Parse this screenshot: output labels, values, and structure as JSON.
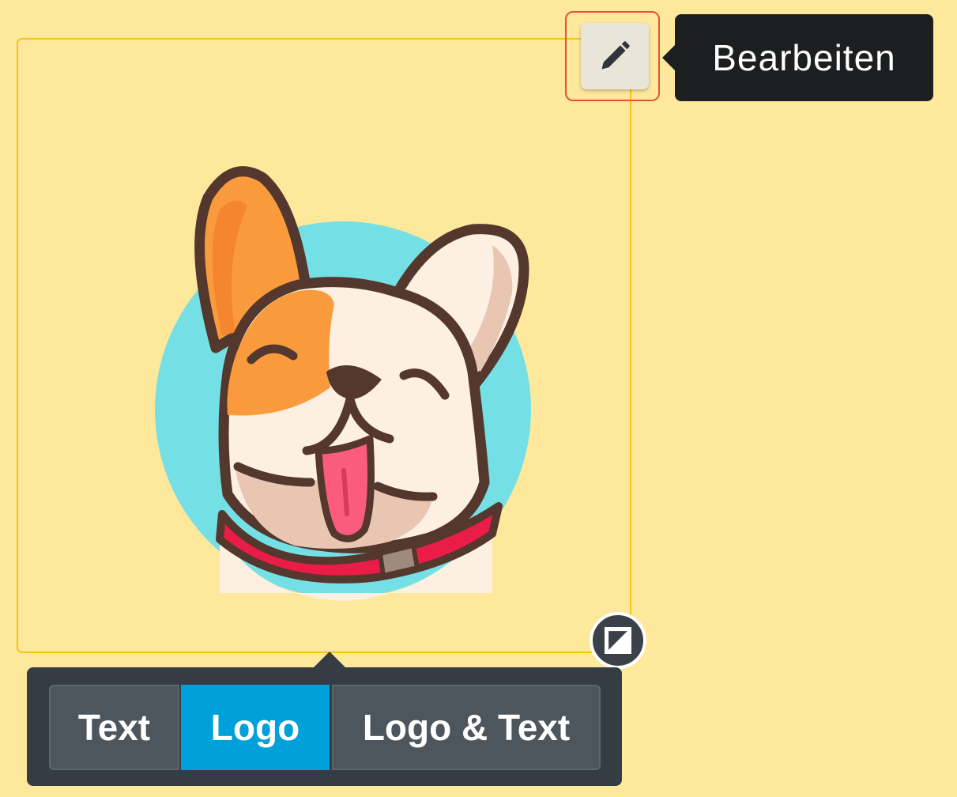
{
  "edit_tooltip": {
    "label": "Bearbeiten",
    "icon": "pencil-icon"
  },
  "resize_handle": {
    "icon": "resize-icon"
  },
  "layout_switcher": {
    "options": [
      {
        "label": "Text",
        "selected": false
      },
      {
        "label": "Logo",
        "selected": true
      },
      {
        "label": "Logo & Text",
        "selected": false
      }
    ]
  },
  "colors": {
    "background": "#fee89c",
    "frame_border": "#f6c217",
    "selected_option": "#00a0da",
    "toolbar": "#353c44",
    "highlight": "#e0533c"
  }
}
